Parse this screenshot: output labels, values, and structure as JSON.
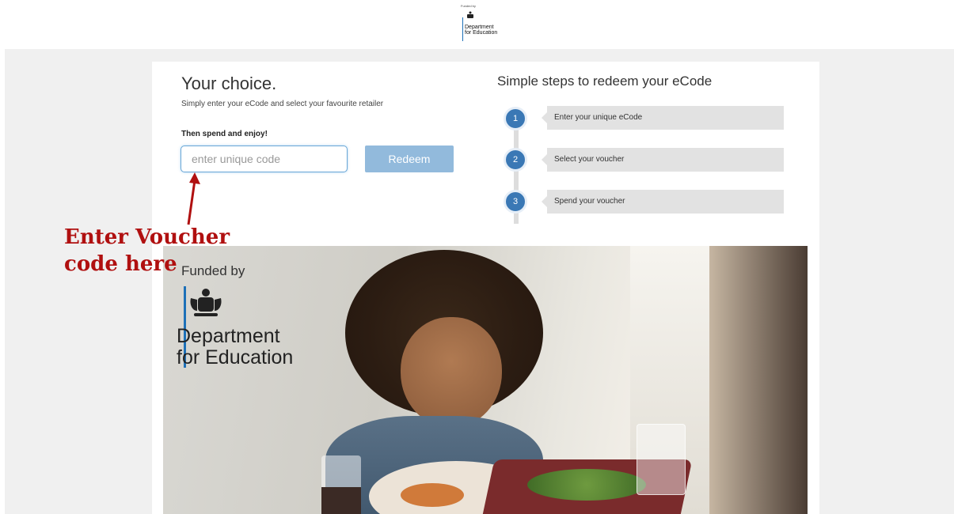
{
  "header": {
    "funded_by": "Funded by",
    "department": [
      "Department",
      "for Education"
    ]
  },
  "main": {
    "title": "Your choice.",
    "subtitle": "Simply enter your eCode and select your favourite retailer",
    "spend_text": "Then spend and enjoy!",
    "code_input": {
      "value": "",
      "placeholder": "enter unique code"
    },
    "redeem_label": "Redeem"
  },
  "steps": {
    "title": "Simple steps to redeem your eCode",
    "items": [
      {
        "number": "1",
        "label": "Enter your unique eCode"
      },
      {
        "number": "2",
        "label": "Select your voucher"
      },
      {
        "number": "3",
        "label": "Spend your voucher"
      }
    ]
  },
  "hero": {
    "funded_by": "Funded by",
    "department_line1": "Department",
    "department_line2": "for Education"
  },
  "annotation": {
    "line1": "Enter Voucher",
    "line2": "code here",
    "color": "#b01010"
  },
  "colors": {
    "accent": "#3a78b5",
    "button": "#92badc",
    "gov_blue": "#1d70b8"
  }
}
